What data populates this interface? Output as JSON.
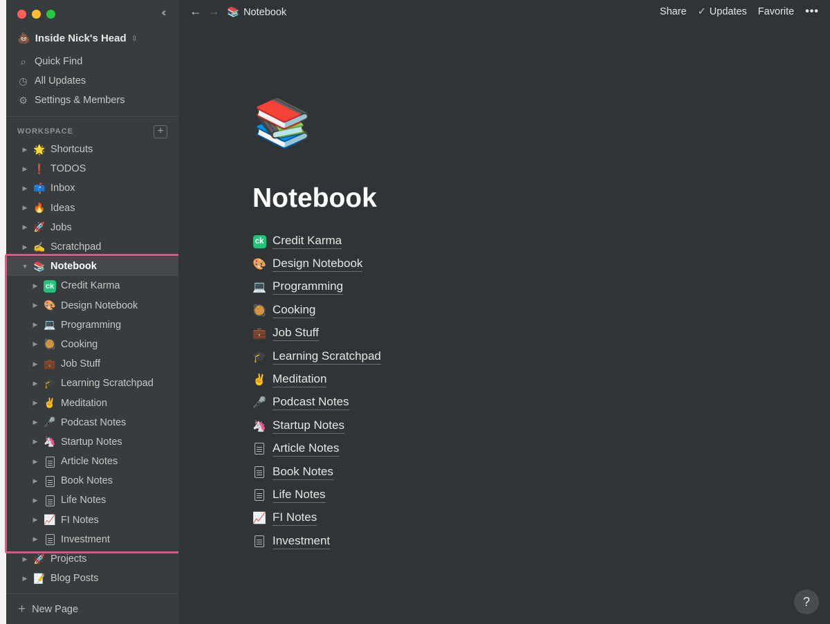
{
  "window": {
    "traffic_lights": [
      "close",
      "minimize",
      "zoom"
    ]
  },
  "sidebar": {
    "collapse_icon": "chevrons-left-icon",
    "workspace_name": "Inside Nick's Head",
    "workspace_emoji": "💩",
    "top_items": [
      {
        "label": "Quick Find",
        "icon": "search-icon"
      },
      {
        "label": "All Updates",
        "icon": "clock-icon"
      },
      {
        "label": "Settings & Members",
        "icon": "gear-icon"
      }
    ],
    "section_label": "WORKSPACE",
    "tree": [
      {
        "label": "Shortcuts",
        "emoji": "🌟"
      },
      {
        "label": "TODOS",
        "emoji": "❗"
      },
      {
        "label": "Inbox",
        "emoji": "📫"
      },
      {
        "label": "Ideas",
        "emoji": "🔥"
      },
      {
        "label": "Jobs",
        "emoji": "🚀"
      },
      {
        "label": "Scratchpad",
        "emoji": "✍️"
      },
      {
        "label": "Notebook",
        "emoji": "📚"
      }
    ],
    "notebook_children": [
      {
        "label": "Credit Karma",
        "emoji": "ck"
      },
      {
        "label": "Design Notebook",
        "emoji": "🎨"
      },
      {
        "label": "Programming",
        "emoji": "💻"
      },
      {
        "label": "Cooking",
        "emoji": "🥘"
      },
      {
        "label": "Job Stuff",
        "emoji": "💼"
      },
      {
        "label": "Learning Scratchpad",
        "emoji": "🎓"
      },
      {
        "label": "Meditation",
        "emoji": "✌️"
      },
      {
        "label": "Podcast Notes",
        "emoji": "🎤"
      },
      {
        "label": "Startup Notes",
        "emoji": "🦄"
      },
      {
        "label": "Article Notes",
        "emoji": "doc"
      },
      {
        "label": "Book Notes",
        "emoji": "doc"
      },
      {
        "label": "Life Notes",
        "emoji": "doc"
      },
      {
        "label": "FI Notes",
        "emoji": "📈"
      },
      {
        "label": "Investment",
        "emoji": "doc"
      }
    ],
    "tree_after": [
      {
        "label": "Projects",
        "emoji": "🚀"
      },
      {
        "label": "Blog Posts",
        "emoji": "📝"
      }
    ],
    "new_page": "New Page"
  },
  "topbar": {
    "breadcrumb_emoji": "📚",
    "breadcrumb": "Notebook",
    "share": "Share",
    "updates": "Updates",
    "favorite": "Favorite",
    "more": "•••"
  },
  "page": {
    "icon": "📚",
    "title": "Notebook",
    "links": [
      {
        "label": "Credit Karma",
        "emoji": "ck"
      },
      {
        "label": "Design Notebook",
        "emoji": "🎨"
      },
      {
        "label": "Programming",
        "emoji": "💻"
      },
      {
        "label": "Cooking",
        "emoji": "🥘"
      },
      {
        "label": "Job Stuff",
        "emoji": "💼"
      },
      {
        "label": "Learning Scratchpad",
        "emoji": "🎓"
      },
      {
        "label": "Meditation",
        "emoji": "✌️"
      },
      {
        "label": "Podcast Notes",
        "emoji": "🎤"
      },
      {
        "label": "Startup Notes",
        "emoji": "🦄"
      },
      {
        "label": "Article Notes",
        "emoji": "doc"
      },
      {
        "label": "Book Notes",
        "emoji": "doc"
      },
      {
        "label": "Life Notes",
        "emoji": "doc"
      },
      {
        "label": "FI Notes",
        "emoji": "📈"
      },
      {
        "label": "Investment",
        "emoji": "doc"
      }
    ]
  },
  "help": "?",
  "colors": {
    "sidebar_bg": "#373c3f",
    "main_bg": "#2f3437",
    "highlight": "#ec4f86",
    "ck_green": "#22c47a"
  }
}
